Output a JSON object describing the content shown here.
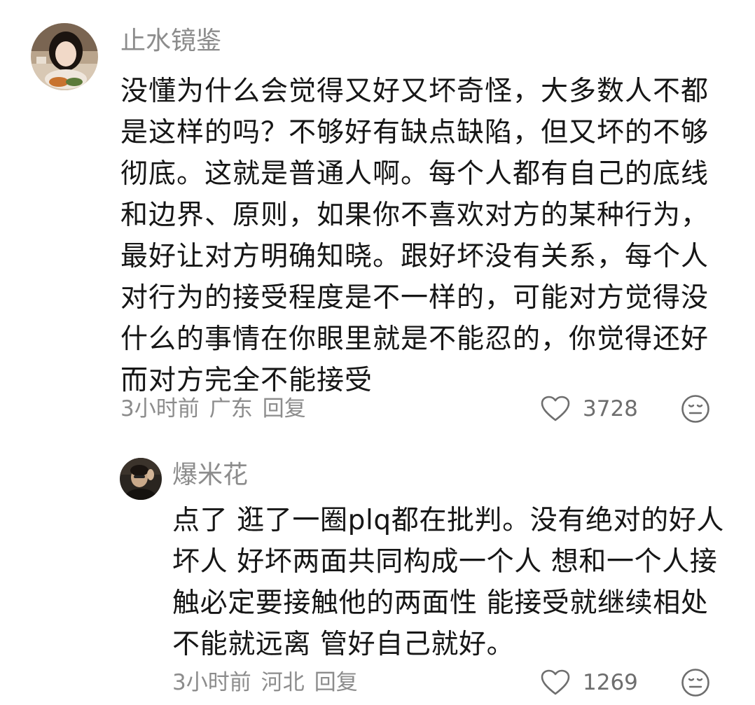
{
  "comments": [
    {
      "username": "止水镜鉴",
      "text": "没懂为什么会觉得又好又坏奇怪，大多数人不都是这样的吗？不够好有缺点缺陷，但又坏的不够彻底。这就是普通人啊。每个人都有自己的底线和边界、原则，如果你不喜欢对方的某种行为，最好让对方明确知晓。跟好坏没有关系，每个人对行为的接受程度是不一样的，可能对方觉得没什么的事情在你眼里就是不能忍的，你觉得还好而对方完全不能接受",
      "time": "3小时前",
      "location": "广东",
      "reply_label": "回复",
      "likes": "3728",
      "avatar_icon": "user-avatar-photo",
      "like_icon": "heart-outline-icon",
      "emoji_icon": "emoji-face-icon"
    },
    {
      "username": "爆米花",
      "text": "点了 逛了一圈plq都在批判。没有绝对的好人坏人 好坏两面共同构成一个人 想和一个人接触必定要接触他的两面性 能接受就继续相处 不能就远离 管好自己就好。",
      "time": "3小时前",
      "location": "河北",
      "reply_label": "回复",
      "likes": "1269",
      "avatar_icon": "user-avatar-photo",
      "like_icon": "heart-outline-icon",
      "emoji_icon": "emoji-face-icon"
    }
  ],
  "colors": {
    "meta_text": "#8c8c8c",
    "body_text": "#161616",
    "icon_stroke": "#6e6e6e"
  }
}
